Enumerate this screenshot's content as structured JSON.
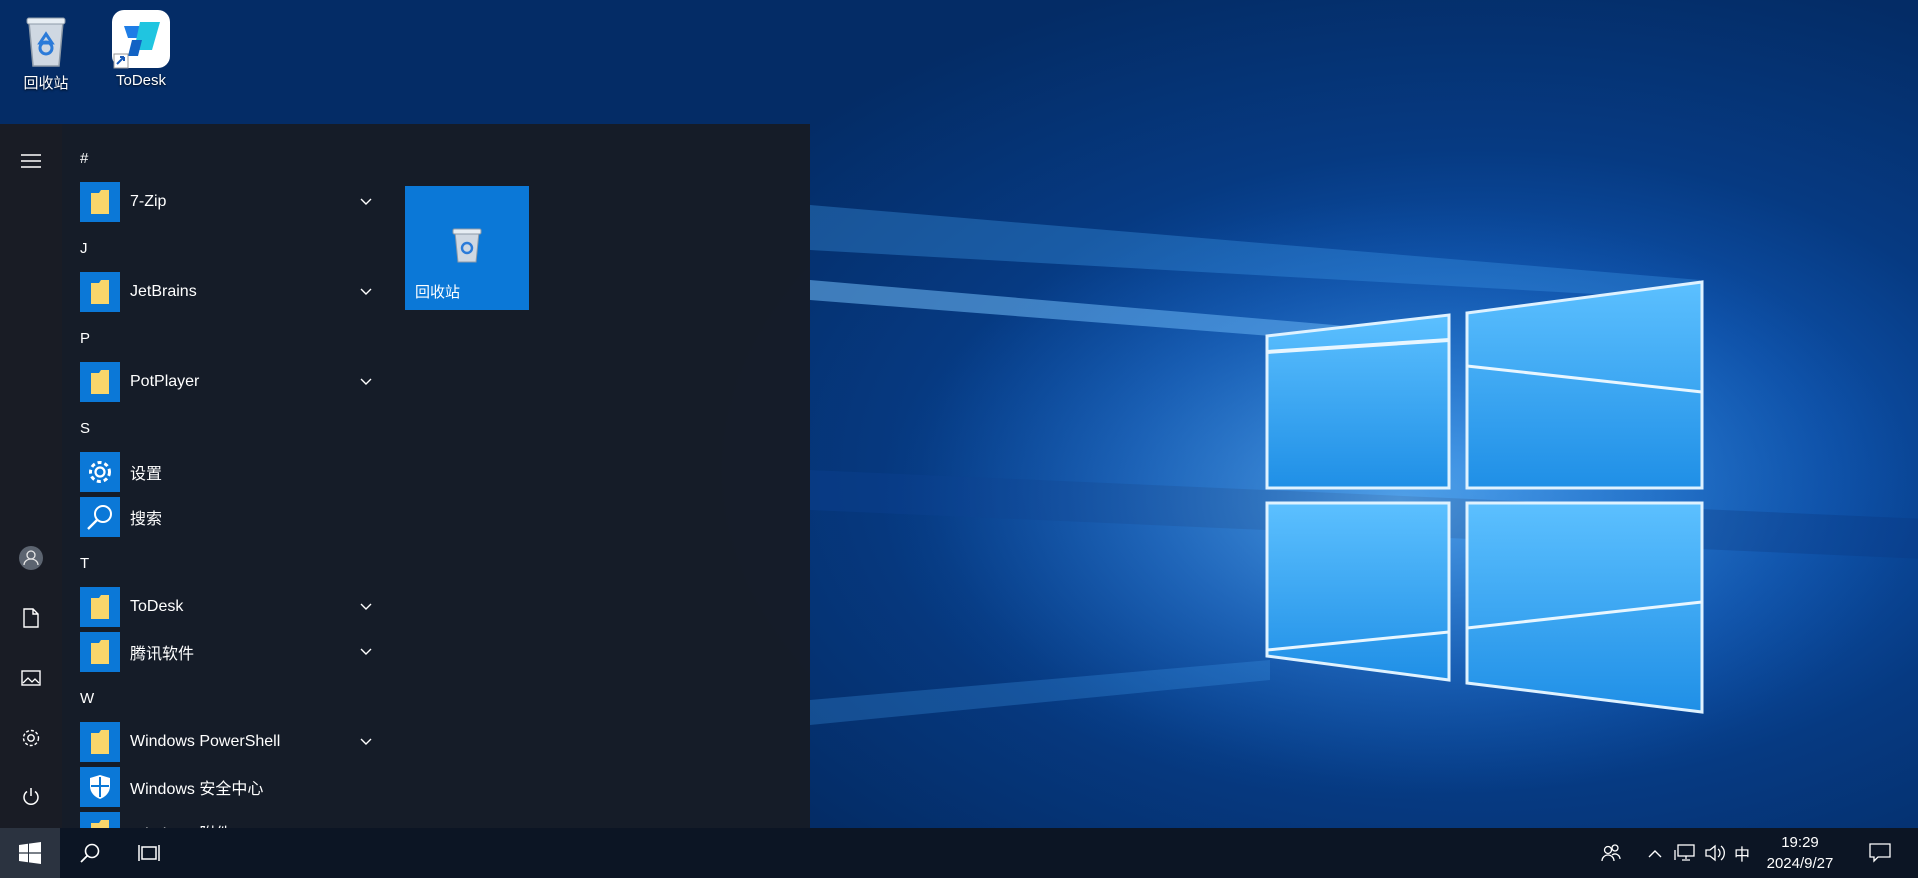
{
  "desktop": {
    "icons": [
      {
        "label": "回收站"
      },
      {
        "label": "ToDesk"
      }
    ]
  },
  "start_menu": {
    "groups": [
      {
        "letter": "#",
        "apps": [
          {
            "label": "7-Zip",
            "icon": "folder-icon",
            "expandable": true
          }
        ]
      },
      {
        "letter": "J",
        "apps": [
          {
            "label": "JetBrains",
            "icon": "folder-icon",
            "expandable": true
          }
        ]
      },
      {
        "letter": "P",
        "apps": [
          {
            "label": "PotPlayer",
            "icon": "folder-icon",
            "expandable": true
          }
        ]
      },
      {
        "letter": "S",
        "apps": [
          {
            "label": "设置",
            "icon": "gear-icon",
            "expandable": false
          },
          {
            "label": "搜索",
            "icon": "search-icon",
            "expandable": false
          }
        ]
      },
      {
        "letter": "T",
        "apps": [
          {
            "label": "ToDesk",
            "icon": "folder-icon",
            "expandable": true
          },
          {
            "label": "腾讯软件",
            "icon": "folder-icon",
            "expandable": true
          }
        ]
      },
      {
        "letter": "W",
        "apps": [
          {
            "label": "Windows PowerShell",
            "icon": "folder-icon",
            "expandable": true
          },
          {
            "label": "Windows 安全中心",
            "icon": "shield-icon",
            "expandable": false
          },
          {
            "label": "Windows 附件",
            "icon": "folder-icon",
            "expandable": true
          }
        ]
      }
    ],
    "tiles": [
      {
        "label": "回收站",
        "icon": "recycle-bin-icon"
      }
    ],
    "rail": [
      "menu-icon",
      "user-avatar-icon",
      "document-icon",
      "pictures-icon",
      "settings-icon",
      "power-icon"
    ]
  },
  "taskbar": {
    "clock_time": "19:29",
    "clock_date": "2024/9/27",
    "ime": "中",
    "tray_icons": [
      "people-icon",
      "chevron-up-icon",
      "network-icon",
      "volume-icon",
      "notification-icon"
    ]
  },
  "colors": {
    "accent": "#0b78d7",
    "start_menu_bg": "#161c26",
    "taskbar_bg": "#0c1524",
    "folder_yellow": "#f9d66b"
  }
}
